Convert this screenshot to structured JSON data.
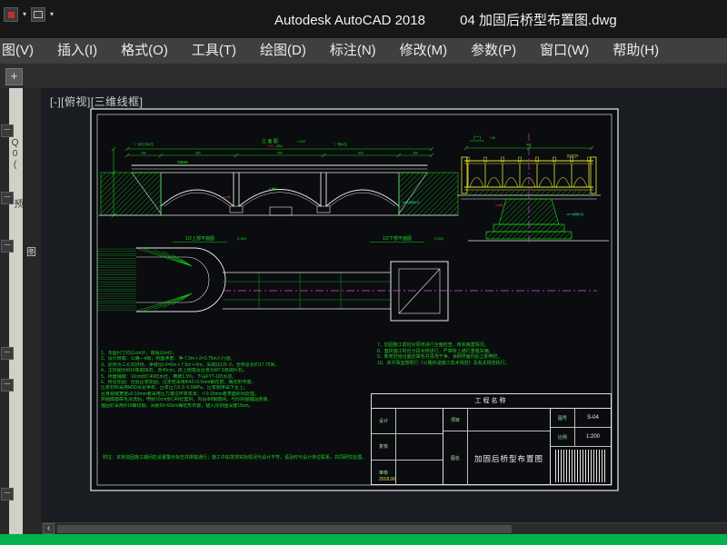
{
  "window": {
    "app_title": "Autodesk AutoCAD 2018",
    "doc_title": "04 加固后桥型布置图.dwg"
  },
  "quick_access": {
    "caret": "▾"
  },
  "menubar": {
    "items": [
      "图(V)",
      "插入(I)",
      "格式(O)",
      "工具(T)",
      "绘图(D)",
      "标注(N)",
      "修改(M)",
      "参数(P)",
      "窗口(W)",
      "帮助(H)"
    ]
  },
  "file_tabs": {
    "new_tab": "+"
  },
  "left_panel": {
    "strip_text_1": "Q0(",
    "strip_text_2": "预",
    "gap_text": "图",
    "collapse_glyph": "—"
  },
  "viewport": {
    "label": "[-][俯视][三维线框]"
  },
  "scrollbar": {
    "left_arrow": "‹"
  },
  "colors": {
    "line_green": "#19c919",
    "line_yellow": "#e6e636",
    "line_magenta": "#e049e0",
    "line_cyan": "#2adede",
    "line_red": "#e84040",
    "taskbar_green": "#00b34f"
  },
  "drawing": {
    "elevation": {
      "title": "立 面 图",
      "scale": "1:200",
      "marker_left": "▽ 设计洪水位",
      "marker_right": "▽ 常水位",
      "red_note": "7.250",
      "red_note2": "C25砼",
      "cyan_note": "M7.5浆砌片石",
      "label_deck": "桥面铺装",
      "label_arch": "主拱圈",
      "dim_total": "3350",
      "dims": [
        "350",
        "850",
        "950",
        "850",
        "350"
      ]
    },
    "plan": {
      "upper_title": "1/2上部平面图",
      "upper_scale": "(1:200)",
      "lower_title": "1/2下部平面图",
      "lower_scale": "(1:200)"
    },
    "section": {
      "title": "(一)",
      "scale": "1:50",
      "dim_total": "820",
      "rail_label": "仿古栏杆",
      "red_note": "C25砼",
      "cyan_note": "M7.5浆砌片石"
    },
    "notes_left": [
      "1、本图尺寸均以cm计，高程以m计。",
      "2、设计荷载：公路—Ⅱ级；桥面净宽：净-7.0m＋2×0.75m人行道。",
      "3、原桥为三孔石拱桥，净跨径L0=5m＋7.5m＋5m，矢跨比1/5~2，全桥总长约17.75米。",
      "4、主拱圈为M10浆砌块石，厚40cm；拱上侧墙及台身为M7.5浆砌片石。",
      "5、桥面铺装：10cm厚C40防水砼，横坡1.5%，下设FYT-1防水层。",
      "6、桥台加固：台后压浆加固，注浆管采用Φ42×3.5mm钢花管，梅花形布置。",
      "   压浆材料采用M30水泥净浆，压浆压力0.3~0.5MPa，压浆顺序由下至上。",
      "   台身裂缝宽度≥0.15mm者采用压力灌注环氧浆液；＜0.15mm者表面封闭处理。",
      "   拱圈底面凿毛清洗后，喷射10cm厚C40砼套拱，内设Φ8钢筋网，与原拱圈锚固连接。",
      "   锚固钉采用Φ16螺纹钢，间距50×50cm梅花形布置，锚入原拱圈深度15cm。"
    ],
    "notes_right": [
      "7、加固施工前应对原桥进行全面检查，核实病害情况。",
      "8、套拱施工时应分段对称进行，严禁桥上通行重载车辆。",
      "9、新老砼结合面应凿毛并清洗干净，涂刷界面剂后立即喷砼。",
      "10、未尽事宜按现行《公路桥涵施工技术规范》及有关规范执行。"
    ],
    "notes_bottom": "附注：本桥加固施工期间应设置警示标志并限载通行；施工中如发现实际情况与设计不符，请及时与设计单位联系，共同研究处理。",
    "titleblock": {
      "header": "工程名称",
      "row1": "设计",
      "row2": "复核",
      "row3": "审核",
      "project_label": "项目",
      "name_label": "图名",
      "drawing_name": "加固后桥型布置图",
      "no_label": "图号",
      "drawing_no": "S-04",
      "scale_label": "比例",
      "scale_value": "1:200",
      "date": "2018.06"
    }
  }
}
